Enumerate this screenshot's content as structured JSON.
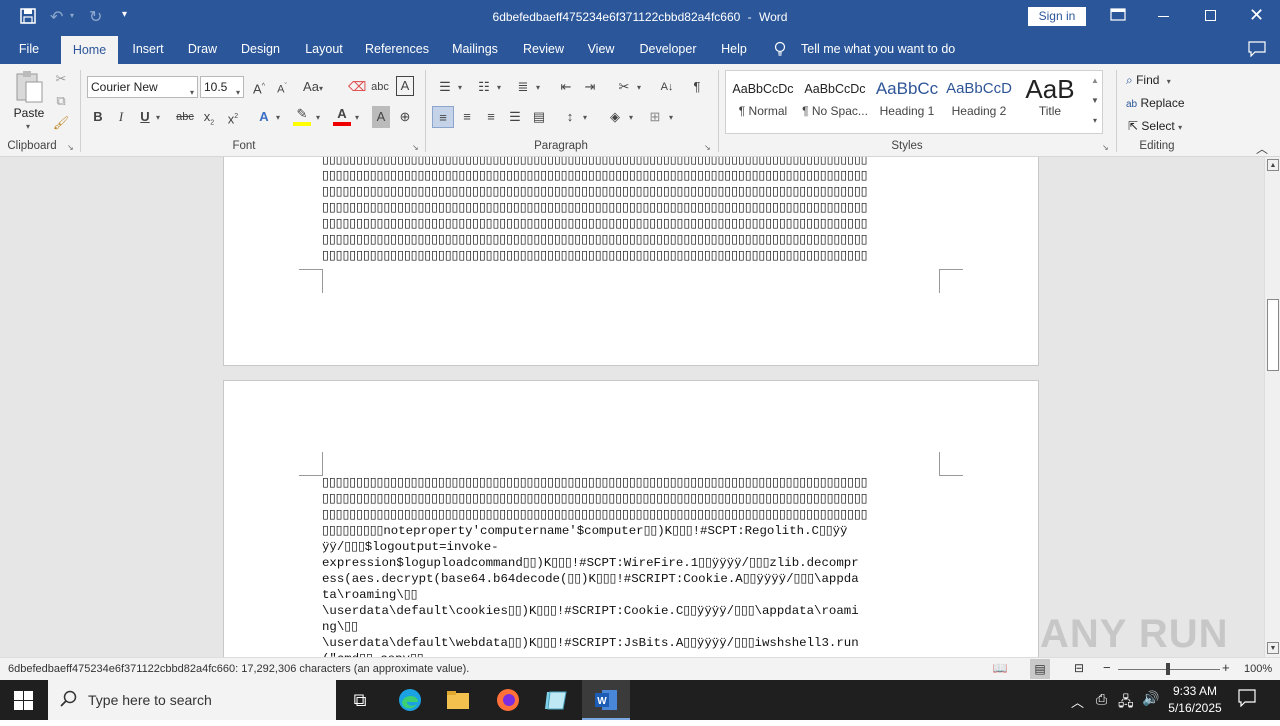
{
  "title_bar": {
    "doc_title": "6dbefedbaeff475234e6f371122cbbd82a4fc660",
    "app_sep": "-",
    "app_name": "Word",
    "sign_in": "Sign in"
  },
  "tabs": [
    "File",
    "Home",
    "Insert",
    "Draw",
    "Design",
    "Layout",
    "References",
    "Mailings",
    "Review",
    "View",
    "Developer",
    "Help"
  ],
  "tell_me": "Tell me what you want to do",
  "ribbon": {
    "clipboard": {
      "label": "Clipboard",
      "paste": "Paste"
    },
    "font": {
      "label": "Font",
      "name": "Courier New",
      "size": "10.5"
    },
    "paragraph": {
      "label": "Paragraph"
    },
    "styles": {
      "label": "Styles",
      "items": [
        {
          "preview": "AaBbCcDc",
          "name": "¶ Normal"
        },
        {
          "preview": "AaBbCcDc",
          "name": "¶ No Spac..."
        },
        {
          "preview": "AaBbCc",
          "name": "Heading 1"
        },
        {
          "preview": "AaBbCcD",
          "name": "Heading 2"
        },
        {
          "preview": "AaB",
          "name": "Title"
        }
      ]
    },
    "editing": {
      "label": "Editing",
      "find": "Find",
      "replace": "Replace",
      "select": "Select"
    }
  },
  "document": {
    "page1_lines": [
      "▯▯▯▯▯▯▯▯▯▯▯▯▯▯▯▯▯▯▯▯▯▯▯▯▯▯▯▯▯▯▯▯▯▯▯▯▯▯▯▯▯▯▯▯▯▯▯▯▯▯▯▯▯▯▯▯▯▯▯▯▯▯▯▯▯▯▯▯▯▯▯▯▯▯▯▯▯▯▯▯",
      "▯▯▯▯▯▯▯▯▯▯▯▯▯▯▯▯▯▯▯▯▯▯▯▯▯▯▯▯▯▯▯▯▯▯▯▯▯▯▯▯▯▯▯▯▯▯▯▯▯▯▯▯▯▯▯▯▯▯▯▯▯▯▯▯▯▯▯▯▯▯▯▯▯▯▯▯▯▯▯▯",
      "▯▯▯▯▯▯▯▯▯▯▯▯▯▯▯▯▯▯▯▯▯▯▯▯▯▯▯▯▯▯▯▯▯▯▯▯▯▯▯▯▯▯▯▯▯▯▯▯▯▯▯▯▯▯▯▯▯▯▯▯▯▯▯▯▯▯▯▯▯▯▯▯▯▯▯▯▯▯▯▯",
      "▯▯▯▯▯▯▯▯▯▯▯▯▯▯▯▯▯▯▯▯▯▯▯▯▯▯▯▯▯▯▯▯▯▯▯▯▯▯▯▯▯▯▯▯▯▯▯▯▯▯▯▯▯▯▯▯▯▯▯▯▯▯▯▯▯▯▯▯▯▯▯▯▯▯▯▯▯▯▯▯",
      "▯▯▯▯▯▯▯▯▯▯▯▯▯▯▯▯▯▯▯▯▯▯▯▯▯▯▯▯▯▯▯▯▯▯▯▯▯▯▯▯▯▯▯▯▯▯▯▯▯▯▯▯▯▯▯▯▯▯▯▯▯▯▯▯▯▯▯▯▯▯▯▯▯▯▯▯▯▯▯▯",
      "▯▯▯▯▯▯▯▯▯▯▯▯▯▯▯▯▯▯▯▯▯▯▯▯▯▯▯▯▯▯▯▯▯▯▯▯▯▯▯▯▯▯▯▯▯▯▯▯▯▯▯▯▯▯▯▯▯▯▯▯▯▯▯▯▯▯▯▯▯▯▯▯▯▯▯▯▯▯▯▯",
      "▯▯▯▯▯▯▯▯▯▯▯▯▯▯▯▯▯▯▯▯▯▯▯▯▯▯▯▯▯▯▯▯▯▯▯▯▯▯▯▯▯▯▯▯▯▯▯▯▯▯▯▯▯▯▯▯▯▯▯▯▯▯▯▯▯▯▯▯▯▯▯▯▯▯▯▯▯▯▯▯"
    ],
    "page2_lines": [
      "▯▯▯▯▯▯▯▯▯▯▯▯▯▯▯▯▯▯▯▯▯▯▯▯▯▯▯▯▯▯▯▯▯▯▯▯▯▯▯▯▯▯▯▯▯▯▯▯▯▯▯▯▯▯▯▯▯▯▯▯▯▯▯▯▯▯▯▯▯▯▯▯▯▯▯▯▯▯▯▯",
      "▯▯▯▯▯▯▯▯▯▯▯▯▯▯▯▯▯▯▯▯▯▯▯▯▯▯▯▯▯▯▯▯▯▯▯▯▯▯▯▯▯▯▯▯▯▯▯▯▯▯▯▯▯▯▯▯▯▯▯▯▯▯▯▯▯▯▯▯▯▯▯▯▯▯▯▯▯▯▯▯",
      "▯▯▯▯▯▯▯▯▯▯▯▯▯▯▯▯▯▯▯▯▯▯▯▯▯▯▯▯▯▯▯▯▯▯▯▯▯▯▯▯▯▯▯▯▯▯▯▯▯▯▯▯▯▯▯▯▯▯▯▯▯▯▯▯▯▯▯▯▯▯▯▯▯▯▯▯▯▯▯▯",
      "▯▯▯▯▯▯▯▯▯noteproperty'computername'$computer▯▯)K▯▯▯!#SCPT:Regolith.C▯▯ÿÿ",
      "ÿÿ/▯▯▯$logoutput=invoke-",
      "expression$loguploadcommand▯▯)K▯▯▯!#SCPT:WireFire.1▯▯ÿÿÿÿ/▯▯▯zlib.decompr",
      "ess(aes.decrypt(base64.b64decode(▯▯)K▯▯▯!#SCRIPT:Cookie.A▯▯ÿÿÿÿ/▯▯▯\\appda",
      "ta\\roaming\\▯▯",
      "\\userdata\\default\\cookies▯▯)K▯▯▯!#SCRIPT:Cookie.C▯▯ÿÿÿÿ/▯▯▯\\appdata\\roami",
      "ng\\▯▯",
      "\\userdata\\default\\webdata▯▯)K▯▯▯!#SCRIPT:JsBits.A▯▯ÿÿÿÿ/▯▯▯iwshshell3.run",
      "(\"cmd▯▯ copy▯▯"
    ]
  },
  "status_bar": {
    "word_count": "6dbefedbaeff475234e6f371122cbbd82a4fc660: 17,292,306 characters (an approximate value).",
    "zoom": "100%",
    "zoom_minus": "−",
    "zoom_plus": "+"
  },
  "watermark": "ANY RUN",
  "taskbar": {
    "search_placeholder": "Type here to search",
    "time": "9:33 AM",
    "date": "5/16/2025"
  },
  "colors": {
    "word_blue": "#2b579a",
    "taskbar": "#1f1f1f",
    "doc_bg": "#e6e6e6"
  }
}
